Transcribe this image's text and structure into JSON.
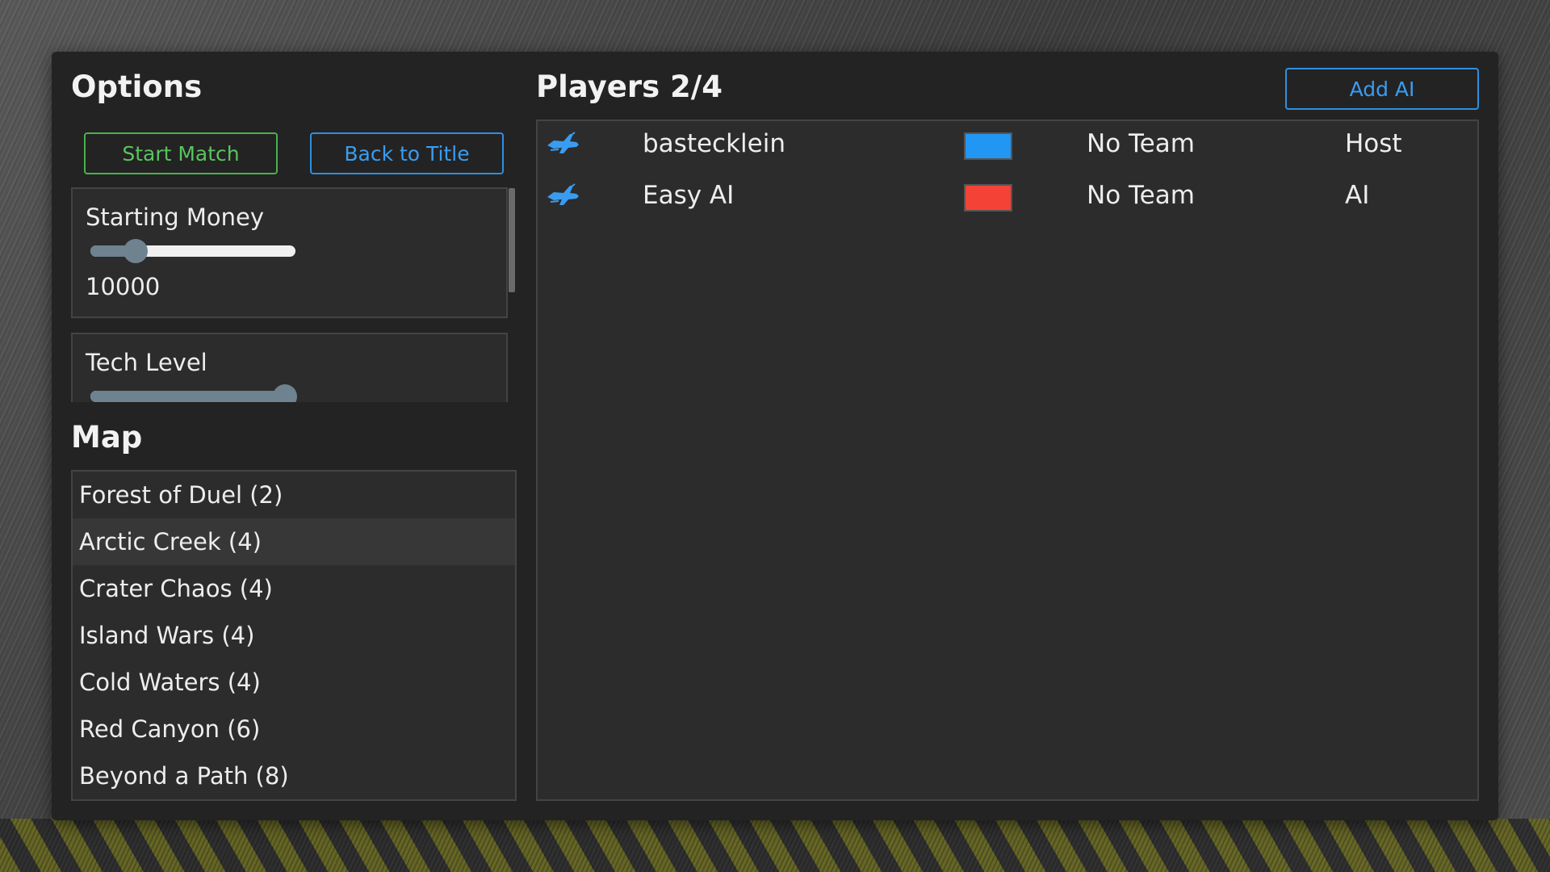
{
  "options": {
    "title": "Options",
    "start_match_label": "Start Match",
    "back_to_title_label": "Back to Title",
    "starting_money": {
      "label": "Starting Money",
      "value": "10000",
      "slider_fraction": 0.22
    },
    "tech_level": {
      "label": "Tech Level",
      "slider_fraction": 0.95
    }
  },
  "map": {
    "title": "Map",
    "items": [
      "Forest of Duel (2)",
      "Arctic Creek (4)",
      "Crater Chaos (4)",
      "Island Wars (4)",
      "Cold Waters (4)",
      "Red Canyon (6)",
      "Beyond a Path (8)"
    ],
    "selected_index": 1
  },
  "players": {
    "title": "Players 2/4",
    "add_ai_label": "Add AI",
    "rows": [
      {
        "icon": "jet-icon",
        "name": "bastecklein",
        "color": "#2196f3",
        "team": "No Team",
        "role": "Host"
      },
      {
        "icon": "jet-icon",
        "name": "Easy AI",
        "color": "#f44336",
        "team": "No Team",
        "role": "AI"
      }
    ]
  }
}
